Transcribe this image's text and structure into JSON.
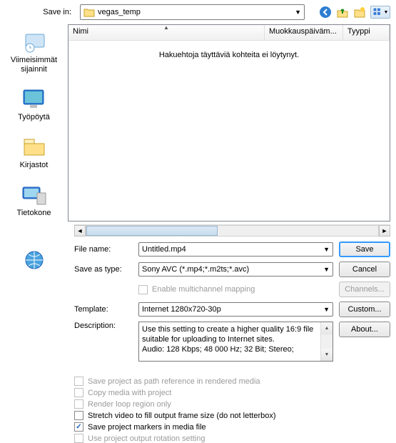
{
  "top": {
    "save_in_label": "Save in:",
    "folder_name": "vegas_temp"
  },
  "places": {
    "recent": "Viimeisimmät sijainnit",
    "desktop": "Työpöytä",
    "libraries": "Kirjastot",
    "computer": "Tietokone"
  },
  "columns": {
    "name": "Nimi",
    "modified": "Muokkauspäiväm...",
    "type": "Tyyppi"
  },
  "list": {
    "empty_text": "Hakuehtoja täyttäviä kohteita ei löytynyt."
  },
  "form": {
    "file_name_label": "File name:",
    "file_name_value": "Untitled.mp4",
    "save_as_type_label": "Save as type:",
    "save_as_type_value": "Sony AVC (*.mp4;*.m2ts;*.avc)",
    "enable_multichannel_label": "Enable multichannel mapping",
    "template_label": "Template:",
    "template_value": "Internet 1280x720-30p",
    "description_label": "Description:",
    "description_text": "Use this setting to create a higher quality 16:9 file suitable for uploading to Internet sites.\nAudio: 128 Kbps; 48 000 Hz; 32 Bit; Stereo;"
  },
  "buttons": {
    "save": "Save",
    "cancel": "Cancel",
    "channels": "Channels...",
    "custom": "Custom...",
    "about": "About..."
  },
  "options": {
    "save_proj_path_ref": "Save project as path reference in rendered media",
    "copy_media": "Copy media with project",
    "render_loop": "Render loop region only",
    "stretch_video": "Stretch video to fill output frame size (do not letterbox)",
    "save_markers": "Save project markers in media file",
    "use_rotation": "Use project output rotation setting"
  }
}
